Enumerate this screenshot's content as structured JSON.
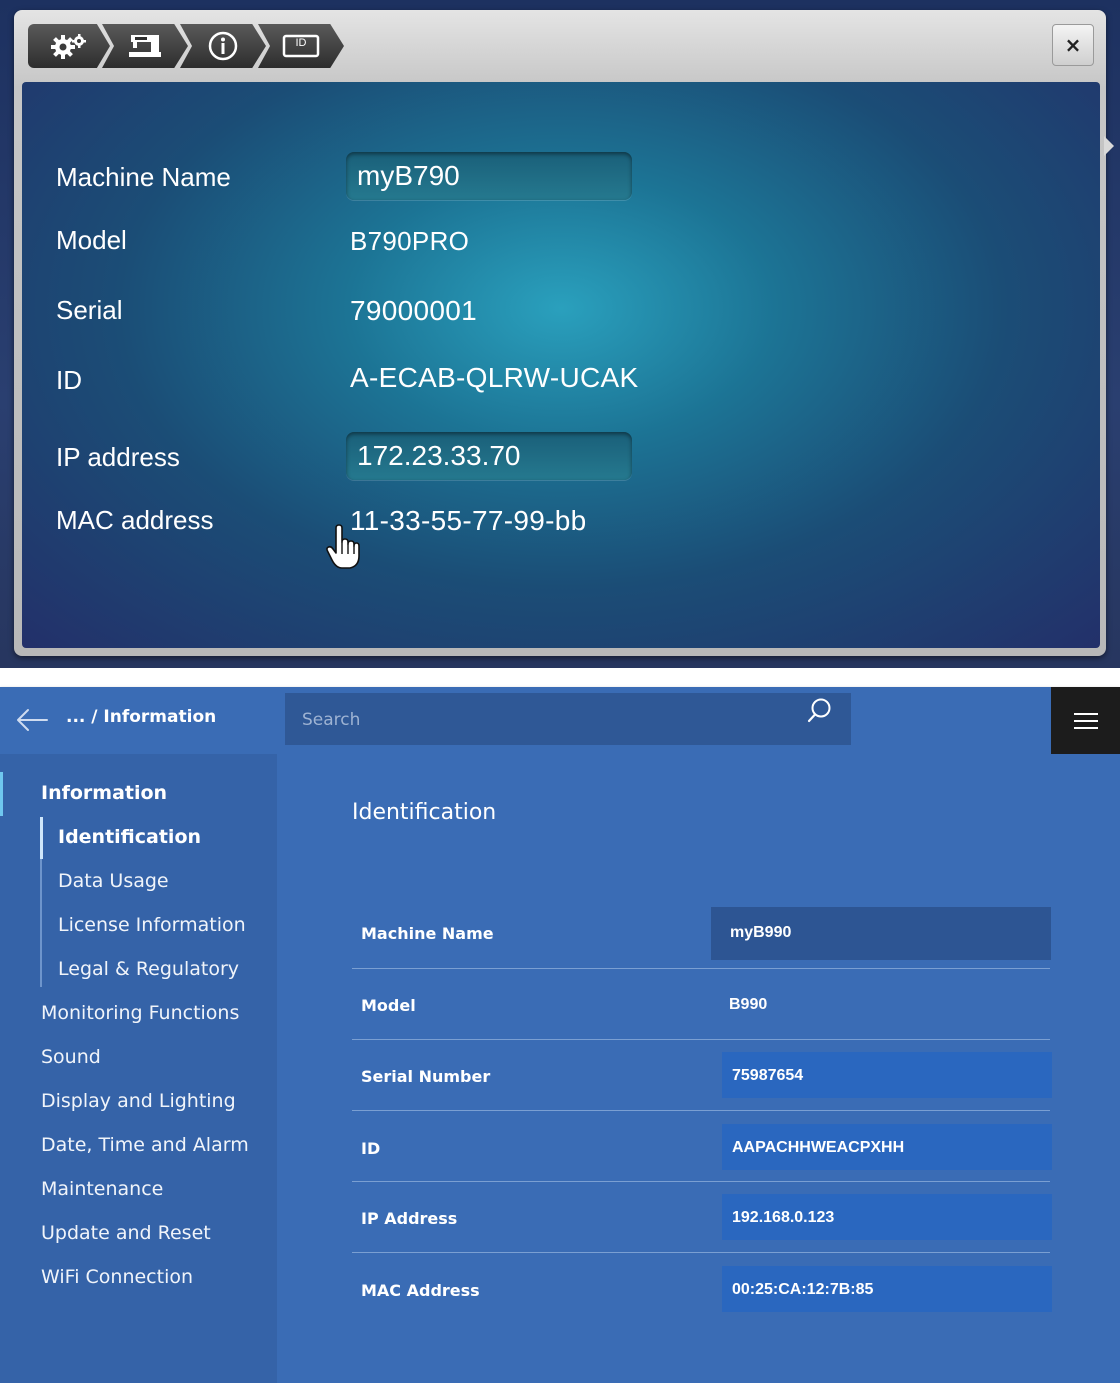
{
  "old_ui": {
    "tabs": [
      {
        "icon": "settings-gears-icon"
      },
      {
        "icon": "sewing-machine-icon"
      },
      {
        "icon": "info-icon"
      },
      {
        "icon": "id-card-icon",
        "text": "ID"
      }
    ],
    "close_label": "×",
    "rows": {
      "machine_name": {
        "label": "Machine Name",
        "value": "myB790"
      },
      "model": {
        "label": "Model",
        "value": "B790PRO"
      },
      "serial": {
        "label": "Serial",
        "value": "79000001"
      },
      "id": {
        "label": "ID",
        "value": "A-ECAB-QLRW-UCAK"
      },
      "ip": {
        "label": "IP address",
        "value": "172.23.33.70"
      },
      "mac": {
        "label": "MAC address",
        "value": "11-33-55-77-99-bb"
      }
    }
  },
  "new_ui": {
    "breadcrumb": "... / Information",
    "search": {
      "placeholder": "Search"
    },
    "sidebar": {
      "section": "Information",
      "sub_items": [
        "Identification",
        "Data Usage",
        "License Information",
        "Legal & Regulatory"
      ],
      "items": [
        "Monitoring Functions",
        "Sound",
        "Display and Lighting",
        "Date, Time and Alarm",
        "Maintenance",
        "Update and Reset",
        "WiFi Connection"
      ]
    },
    "main": {
      "title": "Identification",
      "rows": [
        {
          "label": "Machine Name",
          "value": "myB990"
        },
        {
          "label": "Model",
          "value": "B990"
        },
        {
          "label": "Serial Number",
          "value": "75987654"
        },
        {
          "label": "ID",
          "value": "AAPACHHWEACPXHH"
        },
        {
          "label": "IP Address",
          "value": "192.168.0.123"
        },
        {
          "label": "MAC Address",
          "value": "00:25:CA:12:7B:85"
        }
      ]
    }
  }
}
